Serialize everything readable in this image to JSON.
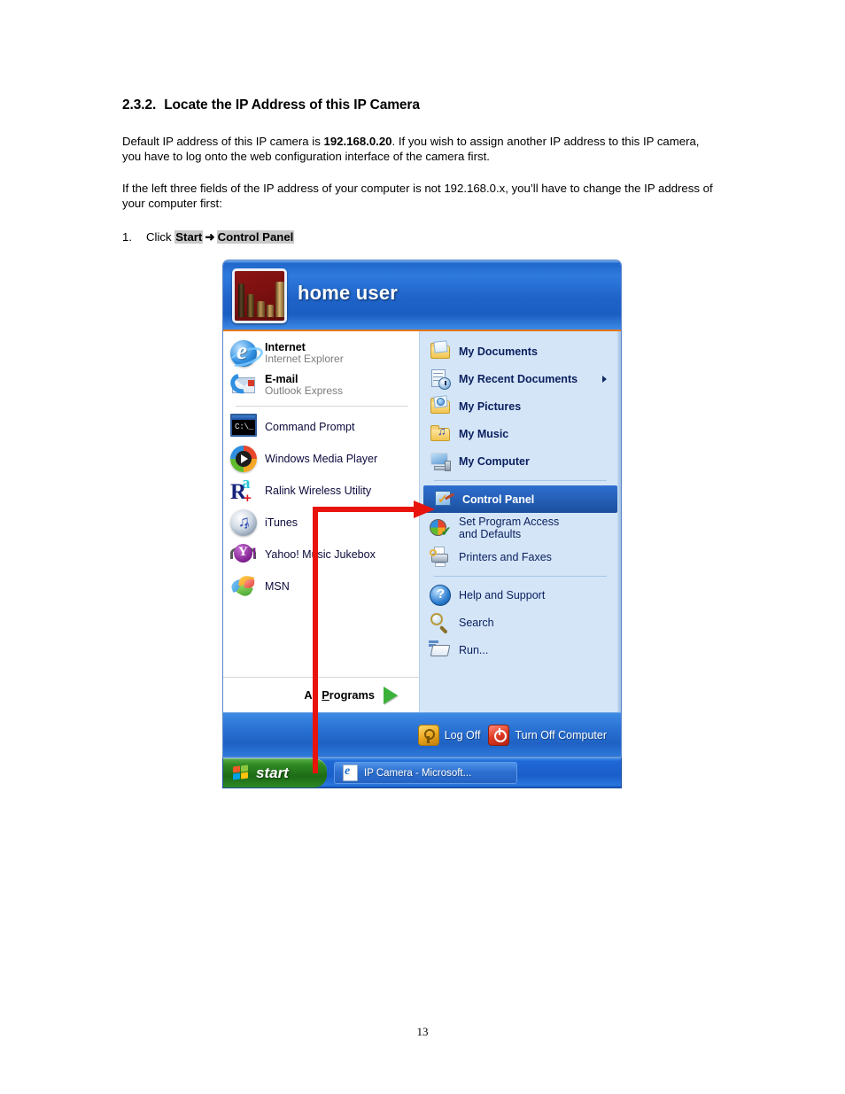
{
  "document": {
    "heading_number": "2.3.2.",
    "heading_text": "Locate the IP Address of this IP Camera",
    "paragraph_1_before": "Default IP address of this IP camera is ",
    "paragraph_1_bold": "192.168.0.20",
    "paragraph_1_after": ". If you wish to assign another IP address to this IP camera, you have to log onto the web configuration interface of the camera first.",
    "paragraph_2": "If the left three fields of the IP address of your computer is not 192.168.0.x, you’ll have to change the IP address of your computer first:",
    "step_number": "1.",
    "step_prefix": "Click ",
    "step_highlight_1": "Start",
    "step_arrow": "➜",
    "step_highlight_2": "Control Panel",
    "page_number": "13"
  },
  "startmenu": {
    "user_name": "home user",
    "avatar_name": "chess-pieces-avatar",
    "left_column": {
      "pinned": [
        {
          "title": "Internet",
          "subtitle": "Internet Explorer",
          "icon": "internet-explorer-icon"
        },
        {
          "title": "E-mail",
          "subtitle": "Outlook Express",
          "icon": "outlook-express-icon"
        }
      ],
      "programs": [
        {
          "title": "Command Prompt",
          "icon": "command-prompt-icon"
        },
        {
          "title": "Windows Media Player",
          "icon": "windows-media-player-icon"
        },
        {
          "title": "Ralink Wireless Utility",
          "icon": "ralink-icon"
        },
        {
          "title": "iTunes",
          "icon": "itunes-icon"
        },
        {
          "title": "Yahoo! Music Jukebox",
          "icon": "yahoo-music-jukebox-icon"
        },
        {
          "title": "MSN",
          "icon": "msn-butterfly-icon"
        }
      ],
      "all_programs_label_a": "All ",
      "all_programs_label_u": "P",
      "all_programs_label_b": "rograms",
      "all_programs_arrow": "green-arrow-icon"
    },
    "right_column": {
      "group_1": [
        {
          "title": "My Documents",
          "icon": "my-documents-folder-icon",
          "submenu": false
        },
        {
          "title": "My Recent Documents",
          "icon": "my-recent-documents-icon",
          "submenu": true,
          "underline": "D"
        },
        {
          "title": "My Pictures",
          "icon": "my-pictures-folder-icon",
          "submenu": false
        },
        {
          "title": "My Music",
          "icon": "my-music-folder-icon",
          "submenu": false
        },
        {
          "title": "My Computer",
          "icon": "my-computer-icon",
          "submenu": false
        }
      ],
      "group_2": [
        {
          "title": "Control Panel",
          "icon": "control-panel-icon",
          "selected": true,
          "underline": "C"
        },
        {
          "title": "Set Program Access and Defaults",
          "icon": "set-program-access-icon",
          "selected": false
        },
        {
          "title": "Printers and Faxes",
          "icon": "printers-and-faxes-icon",
          "selected": false
        }
      ],
      "group_3": [
        {
          "title": "Help and Support",
          "icon": "help-and-support-icon",
          "underline": "H"
        },
        {
          "title": "Search",
          "icon": "search-icon",
          "underline": "S"
        },
        {
          "title": "Run...",
          "icon": "run-icon",
          "underline": "R"
        }
      ]
    },
    "footer": {
      "log_off_label": "Log Off",
      "log_off_icon": "key-icon",
      "turn_off_label": "Turn Off Computer",
      "turn_off_icon": "power-icon"
    },
    "taskbar": {
      "start_label": "start",
      "start_icon": "windows-flag-icon",
      "window_button_label": "IP Camera - Microsoft...",
      "window_button_icon": "internet-explorer-document-icon"
    },
    "annotation": {
      "type": "red-arrow",
      "color": "#e8140c",
      "description": "arrow from Start button up to Control Panel"
    }
  }
}
